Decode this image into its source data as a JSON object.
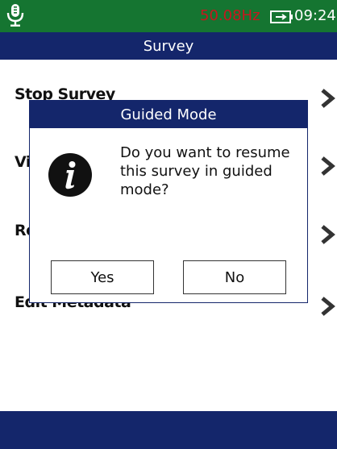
{
  "status_bar": {
    "frequency": "50.08Hz",
    "time": "09:24",
    "icons": [
      "microphone-icon",
      "battery-icon"
    ],
    "frequency_color": "#c8161e",
    "background_color": "#157531"
  },
  "title_bar": {
    "title": "Survey",
    "background_color": "#14266b"
  },
  "menu": {
    "items": [
      {
        "label": "Stop Survey"
      },
      {
        "label": "Vi"
      },
      {
        "label": "Re"
      },
      {
        "label": "Edit Metadata"
      }
    ]
  },
  "dialog": {
    "title": "Guided Mode",
    "icon": "info-icon",
    "message": "Do you want to resume this survey in guided mode?",
    "yes_label": "Yes",
    "no_label": "No"
  }
}
